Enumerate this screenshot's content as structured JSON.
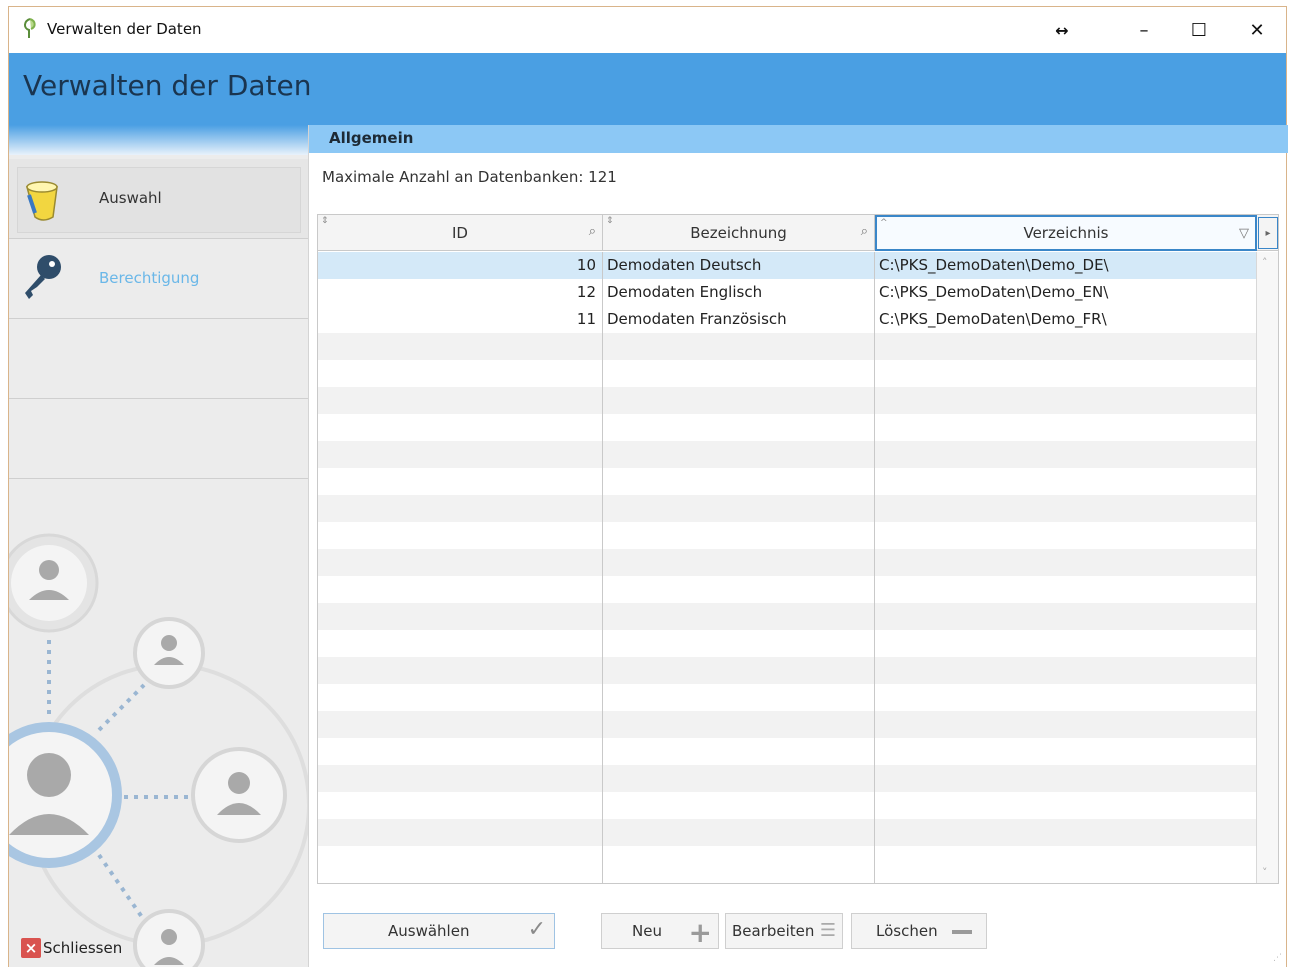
{
  "window": {
    "title": "Verwalten der Daten",
    "resize_glyph": "↔",
    "minimize_glyph": "–",
    "maximize_glyph": "☐",
    "close_glyph": "✕"
  },
  "header": {
    "title": "Verwalten der Daten"
  },
  "sidebar": {
    "items": [
      {
        "label": "Auswahl",
        "icon": "bucket-icon",
        "active": true
      },
      {
        "label": "Berechtigung",
        "icon": "key-icon",
        "active": false
      }
    ],
    "close_label": "Schliessen"
  },
  "section": {
    "title": "Allgemein"
  },
  "info": {
    "max_db_text": "Maximale Anzahl an Datenbanken: 121"
  },
  "grid": {
    "columns": [
      "ID",
      "Bezeichnung",
      "Verzeichnis"
    ],
    "rows": [
      {
        "id": "10",
        "bezeichnung": "Demodaten Deutsch",
        "verzeichnis": "C:\\PKS_DemoDaten\\Demo_DE\\"
      },
      {
        "id": "12",
        "bezeichnung": "Demodaten Englisch",
        "verzeichnis": "C:\\PKS_DemoDaten\\Demo_EN\\"
      },
      {
        "id": "11",
        "bezeichnung": "Demodaten Französisch",
        "verzeichnis": "C:\\PKS_DemoDaten\\Demo_FR\\"
      }
    ],
    "selected_row": 0
  },
  "buttons": {
    "select": "Auswählen",
    "new": "Neu",
    "edit": "Bearbeiten",
    "delete": "Löschen"
  },
  "colors": {
    "header_blue": "#4a9fe3",
    "section_blue": "#8cc8f5",
    "selection": "#d4e9f8",
    "link": "#6ab7e8"
  }
}
